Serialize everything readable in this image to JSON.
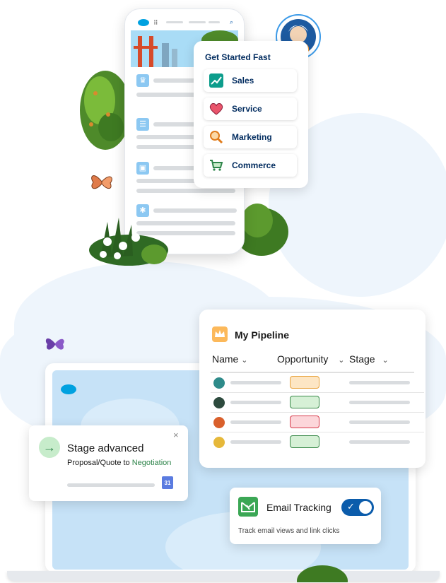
{
  "get_started": {
    "title": "Get Started Fast",
    "items": [
      {
        "label": "Sales",
        "icon": "chart-up-icon"
      },
      {
        "label": "Service",
        "icon": "heart-icon"
      },
      {
        "label": "Marketing",
        "icon": "magnifier-icon"
      },
      {
        "label": "Commerce",
        "icon": "cart-icon"
      }
    ]
  },
  "pipeline": {
    "title": "My Pipeline",
    "columns": [
      "Name",
      "Opportunity",
      "Stage"
    ],
    "rows": [
      {
        "avatar_color": "#2e8b8a",
        "chip_border": "#e8a33d",
        "chip_fill": "#fde6c4"
      },
      {
        "avatar_color": "#2d4a3e",
        "chip_border": "#3a8a4a",
        "chip_fill": "#d6f0d6"
      },
      {
        "avatar_color": "#d9602c",
        "chip_border": "#d63a4a",
        "chip_fill": "#fcd6da"
      },
      {
        "avatar_color": "#e6b83a",
        "chip_border": "#3a8a4a",
        "chip_fill": "#d6f0d6"
      }
    ]
  },
  "stage": {
    "title": "Stage advanced",
    "from": "Proposal/Quote to",
    "to": "Negotiation",
    "calendar_day": "31",
    "close": "×"
  },
  "email": {
    "title": "Email Tracking",
    "description": "Track email views and link clicks",
    "toggle_on": true
  },
  "colors": {
    "brand_blue": "#00a1e0",
    "navy": "#032d60",
    "link_green": "#2e844a",
    "toggle_blue": "#0b5cab"
  }
}
